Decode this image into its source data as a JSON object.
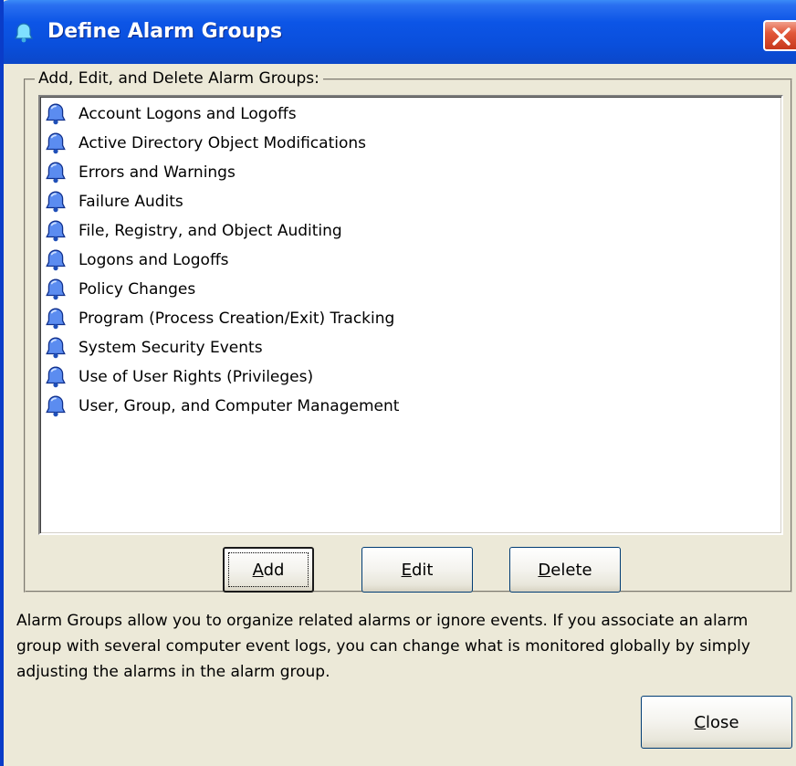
{
  "window": {
    "title": "Define Alarm Groups",
    "title_icon": "bell-icon",
    "close_icon": "close-icon"
  },
  "group_box": {
    "legend": "Add, Edit, and Delete Alarm Groups:"
  },
  "alarm_groups": [
    {
      "label": "Account Logons and Logoffs",
      "icon": "bell-icon"
    },
    {
      "label": "Active Directory Object Modifications",
      "icon": "bell-icon"
    },
    {
      "label": "Errors and Warnings",
      "icon": "bell-icon"
    },
    {
      "label": "Failure Audits",
      "icon": "bell-icon"
    },
    {
      "label": "File, Registry, and Object Auditing",
      "icon": "bell-icon"
    },
    {
      "label": "Logons and Logoffs",
      "icon": "bell-icon"
    },
    {
      "label": "Policy Changes",
      "icon": "bell-icon"
    },
    {
      "label": "Program (Process Creation/Exit) Tracking",
      "icon": "bell-icon"
    },
    {
      "label": "System Security Events",
      "icon": "bell-icon"
    },
    {
      "label": "Use of User Rights (Privileges)",
      "icon": "bell-icon"
    },
    {
      "label": "User, Group, and Computer Management",
      "icon": "bell-icon"
    }
  ],
  "buttons": {
    "add": "Add",
    "edit": "Edit",
    "delete": "Delete",
    "close": "Close"
  },
  "description": "Alarm Groups allow you to organize related alarms or ignore events.  If you associate an alarm group with several computer event logs, you can change what is monitored globally by simply adjusting the alarms in the alarm group.",
  "colors": {
    "titlebar": "#0a4fdc",
    "dialog_bg": "#ece9d8",
    "bell": "#1f5fd6",
    "close_button": "#d8492b"
  }
}
